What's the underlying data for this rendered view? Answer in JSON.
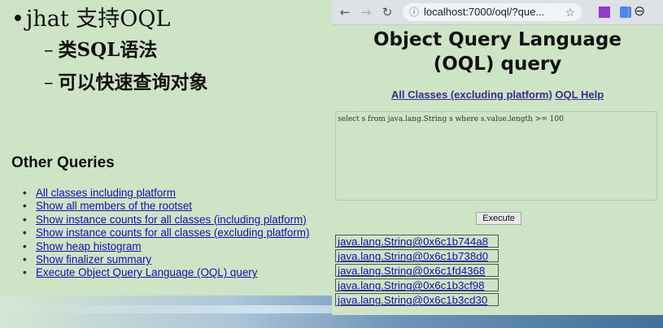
{
  "slide": {
    "bullet_main": "jhat 支持OQL",
    "sub_bullets": [
      "类SQL语法",
      "可以快速查询对象"
    ]
  },
  "other_queries": {
    "title": "Other Queries",
    "links": [
      "All classes including platform",
      "Show all members of the rootset",
      "Show instance counts for all classes (including platform)",
      "Show instance counts for all classes (excluding platform)",
      "Show heap histogram",
      "Show finalizer summary",
      "Execute Object Query Language (OQL) query"
    ]
  },
  "browser": {
    "url": "localhost:7000/oql/?que...",
    "page_title_line1": "Object Query Language",
    "page_title_line2": "(OQL) query",
    "link_all_classes": "All Classes (excluding platform)",
    "link_oql_help": "OQL Help",
    "query_text": "select s from java.lang.String s where s.value.length >= 100",
    "execute_label": "Execute",
    "results": [
      "java.lang.String@0x6c1b744a8",
      "java.lang.String@0x6c1b738d0",
      "java.lang.String@0x6c1fd4368",
      "java.lang.String@0x6c1b3cf98",
      "java.lang.String@0x6c1b3cd30"
    ]
  }
}
